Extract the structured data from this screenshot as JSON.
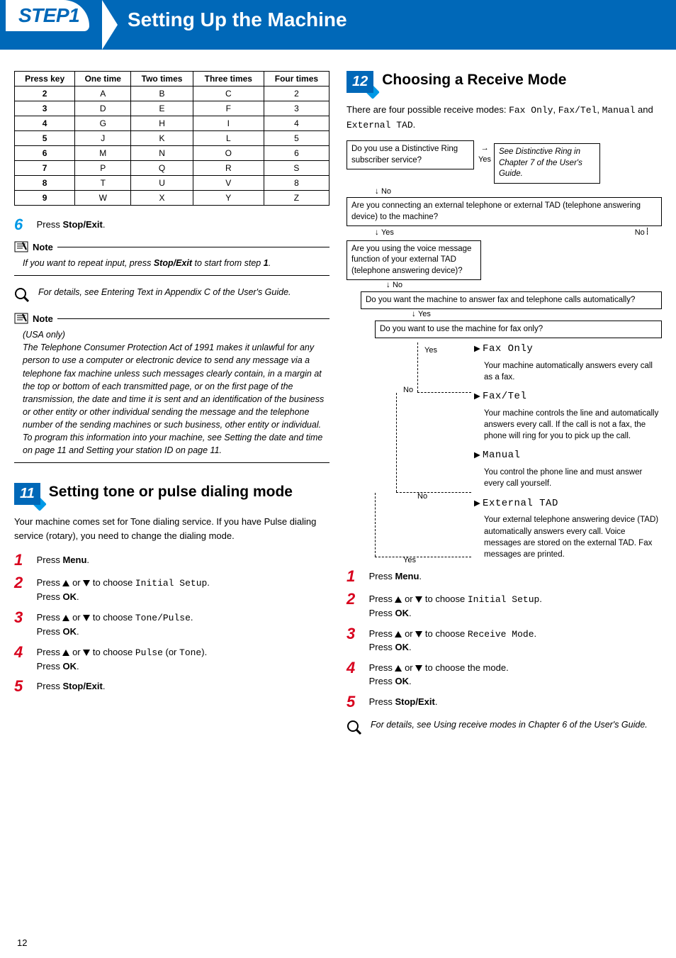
{
  "topbar": {
    "step": "STEP1",
    "title": "Setting Up the Machine"
  },
  "keyTable": {
    "headers": [
      "Press key",
      "One time",
      "Two times",
      "Three times",
      "Four times"
    ],
    "rows": [
      [
        "2",
        "A",
        "B",
        "C",
        "2"
      ],
      [
        "3",
        "D",
        "E",
        "F",
        "3"
      ],
      [
        "4",
        "G",
        "H",
        "I",
        "4"
      ],
      [
        "5",
        "J",
        "K",
        "L",
        "5"
      ],
      [
        "6",
        "M",
        "N",
        "O",
        "6"
      ],
      [
        "7",
        "P",
        "Q",
        "R",
        "S"
      ],
      [
        "8",
        "T",
        "U",
        "V",
        "8"
      ],
      [
        "9",
        "W",
        "X",
        "Y",
        "Z"
      ]
    ]
  },
  "left": {
    "step6": {
      "num": "6",
      "pre": "Press ",
      "bold": "Stop/Exit",
      "post": "."
    },
    "note1Label": "Note",
    "note1": {
      "pre": "If you want to repeat input, press ",
      "bold": "Stop/Exit",
      "mid": " to start from step ",
      "boldNum": "1",
      "post": "."
    },
    "infoText": "For details, see Entering Text in Appendix C of the User's Guide.",
    "note2Label": "Note",
    "note2Body": "(USA only)\nThe Telephone Consumer Protection Act of 1991 makes it unlawful for any person to use a computer or electronic device to send any message via a telephone fax machine unless such messages clearly contain, in a margin at the top or bottom of each transmitted page, or on the first page of the transmission, the date and time it is sent and an identification of the business or other entity or other individual sending the message and the telephone number of the sending machines or such business, other entity or individual.\nTo program this information into your machine, see Setting the date and time on page 11 and Setting your station ID on page 11.",
    "sec11": {
      "badge": "11",
      "title": "Setting tone or pulse dialing mode"
    },
    "sec11Intro": "Your machine comes set for Tone dialing service. If you have Pulse dialing service (rotary), you need to change the dialing mode.",
    "s11_1": {
      "num": "1",
      "pre": "Press ",
      "bold": "Menu",
      "post": "."
    },
    "s11_2": {
      "num": "2",
      "part1": "Press ",
      "part2": " or ",
      "part3": " to choose ",
      "mono": "Initial Setup",
      "part4": ".",
      "line2pre": "Press ",
      "line2bold": "OK",
      "line2post": "."
    },
    "s11_3": {
      "num": "3",
      "part1": "Press ",
      "part2": " or ",
      "part3": " to choose ",
      "mono": "Tone/Pulse",
      "part4": ".",
      "line2pre": "Press ",
      "line2bold": "OK",
      "line2post": "."
    },
    "s11_4": {
      "num": "4",
      "part1": "Press ",
      "part2": " or ",
      "part3": " to choose ",
      "mono1": "Pulse",
      "mid": " (or ",
      "mono2": "Tone",
      "part4": ").",
      "line2pre": "Press ",
      "line2bold": "OK",
      "line2post": "."
    },
    "s11_5": {
      "num": "5",
      "pre": "Press ",
      "bold": "Stop/Exit",
      "post": "."
    }
  },
  "right": {
    "sec12": {
      "badge": "12",
      "title": "Choosing a Receive Mode"
    },
    "intro": {
      "pre": "There are four possible receive modes: ",
      "m1": "Fax Only",
      "m2": "Fax/Tel",
      "m3": "Manual",
      "and": " and ",
      "m4": "External TAD",
      "post": "."
    },
    "flow": {
      "q1": "Do you use a Distinctive Ring subscriber service?",
      "q1yes": "Yes",
      "q1no": "No",
      "q1yesText": "See Distinctive Ring in Chapter 7 of the User's Guide.",
      "q2": "Are you connecting an external telephone or external TAD (telephone answering device) to the machine?",
      "q2yes": "Yes",
      "q2no": "No",
      "q3": "Are you using the voice message function of your external TAD (telephone answering device)?",
      "q3no": "No",
      "q3yes": "Yes",
      "q4": "Do you want the machine to answer fax and telephone calls automatically?",
      "q4yes": "Yes",
      "q4no": "No",
      "q5": "Do you want to use the machine for fax only?",
      "q5yes": "Yes",
      "q5no": "No",
      "modeFaxOnly": "Fax Only",
      "modeFaxOnlyDesc": "Your machine automatically answers every call as a fax.",
      "modeFaxTel": "Fax/Tel",
      "modeFaxTelDesc": "Your machine controls the line and automatically answers every call. If the call is not a fax, the phone will ring for you to pick up the call.",
      "modeManual": "Manual",
      "modeManualDesc": "You control the phone line and must answer every call yourself.",
      "modeExtTAD": "External TAD",
      "modeExtTADDesc": "Your external telephone answering device (TAD) automatically answers every call. Voice messages are stored on the external TAD. Fax messages are printed."
    },
    "s12_1": {
      "num": "1",
      "pre": "Press ",
      "bold": "Menu",
      "post": "."
    },
    "s12_2": {
      "num": "2",
      "part1": "Press ",
      "part2": " or ",
      "part3": " to choose ",
      "mono": "Initial Setup",
      "part4": ".",
      "line2pre": "Press ",
      "line2bold": "OK",
      "line2post": "."
    },
    "s12_3": {
      "num": "3",
      "part1": "Press ",
      "part2": " or ",
      "part3": " to choose ",
      "mono": "Receive Mode",
      "part4": ".",
      "line2pre": "Press ",
      "line2bold": "OK",
      "line2post": "."
    },
    "s12_4": {
      "num": "4",
      "part1": "Press ",
      "part2": " or ",
      "part3": " to choose the mode.",
      "line2pre": "Press ",
      "line2bold": "OK",
      "line2post": "."
    },
    "s12_5": {
      "num": "5",
      "pre": "Press ",
      "bold": "Stop/Exit",
      "post": "."
    },
    "infoText": "For details, see Using receive modes in Chapter 6 of the User's Guide."
  },
  "pageNumber": "12"
}
